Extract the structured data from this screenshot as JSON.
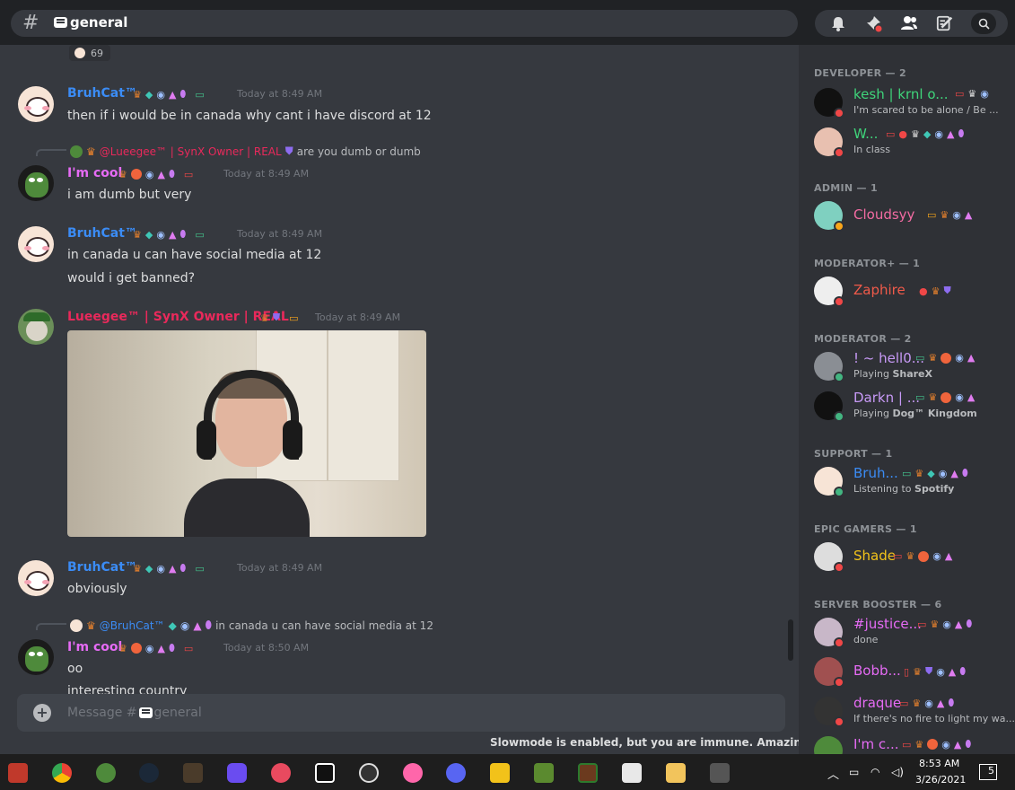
{
  "header": {
    "channel": "general"
  },
  "reaction": {
    "count": "69"
  },
  "messages": {
    "m1": {
      "author": "BruhCat™",
      "time": "Today at 8:49 AM",
      "lines": [
        "then if i would be in canada why cant i have discord at 12"
      ]
    },
    "m2": {
      "reply_author": "@Lueegee™ | SynX Owner | REAL",
      "reply_text": "are you dumb or dumb",
      "author": "I'm cool",
      "time": "Today at 8:49 AM",
      "lines": [
        "i am dumb but very"
      ]
    },
    "m3": {
      "author": "BruhCat™",
      "time": "Today at 8:49 AM",
      "lines": [
        "in canada u can have social media at 12",
        "would i get banned?"
      ]
    },
    "m4": {
      "author": "Lueegee™ | SynX Owner | REAL",
      "time": "Today at 8:49 AM"
    },
    "m5": {
      "author": "BruhCat™",
      "time": "Today at 8:49 AM",
      "lines": [
        "obviously"
      ]
    },
    "m6": {
      "reply_author": "@BruhCat™",
      "reply_text": "in canada u can have social media at 12",
      "author": "I'm cool",
      "time": "Today at 8:50 AM",
      "lines": [
        "oo",
        "interesting country"
      ]
    }
  },
  "composer": {
    "placeholder_prefix": "Message #",
    "channel": "general"
  },
  "slowmode": "Slowmode is enabled, but you are immune. Amazing!",
  "members": {
    "developer": {
      "title": "DEVELOPER — 2"
    },
    "d1": {
      "name": "kesh | krnl o...",
      "sub": "I'm scared to be alone / Be ..."
    },
    "d2": {
      "name": "W...",
      "sub": "In class"
    },
    "admin": {
      "title": "ADMIN — 1"
    },
    "a1": {
      "name": "Cloudsyy"
    },
    "modplus": {
      "title": "MODERATOR+ — 1"
    },
    "mp1": {
      "name": "Zaphire"
    },
    "mod": {
      "title": "MODERATOR — 2"
    },
    "mo1": {
      "name": "! ~ hell0...",
      "sub_prefix": "Playing ",
      "sub_bold": "ShareX"
    },
    "mo2": {
      "name": "Darkn | ...",
      "sub_prefix": "Playing ",
      "sub_bold": "Dog™ Kingdom"
    },
    "support": {
      "title": "SUPPORT — 1"
    },
    "s1": {
      "name": "Bruh...",
      "sub_prefix": "Listening to ",
      "sub_bold": "Spotify"
    },
    "epic": {
      "title": "EPIC GAMERS — 1"
    },
    "e1": {
      "name": "Shade"
    },
    "booster": {
      "title": "SERVER BOOSTER — 6"
    },
    "b1": {
      "name": "#justice...",
      "sub": "done"
    },
    "b2": {
      "name": "Bobb..."
    },
    "b3": {
      "name": "draque",
      "sub": "If there's no fire to light my wa..."
    },
    "b4": {
      "name": "I'm c..."
    }
  },
  "taskbar": {
    "time": "8:53 AM",
    "date": "3/26/2021",
    "notifications": "5"
  },
  "colors": {
    "bruhcat": "#3b8cf5",
    "imcool": "#e66bf5",
    "lueegee": "#e9295b",
    "developer_green": "#3fd47a",
    "admin_pink": "#f26ba2",
    "moderator_plus": "#f05a4a",
    "moderator": "#c89af7",
    "shade": "#f2c21a"
  }
}
